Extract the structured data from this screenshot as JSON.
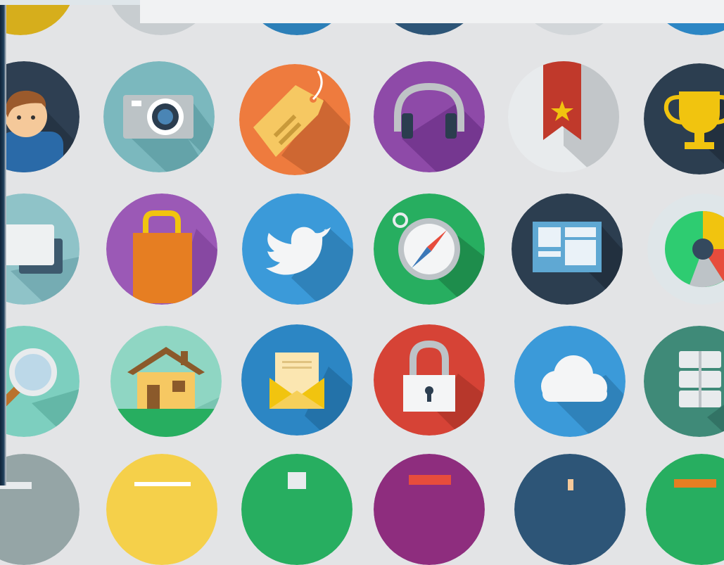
{
  "scene": {
    "description_colors": {
      "background": "#e3e4e6",
      "shadow": "rgba(0,0,0,0.22)"
    }
  },
  "icons": [
    {
      "name": "user-avatar-icon",
      "bg": "#2e3f52"
    },
    {
      "name": "camera-icon",
      "bg": "#7bb8be"
    },
    {
      "name": "price-tag-icon",
      "bg": "#ee7b3e"
    },
    {
      "name": "headphones-icon",
      "bg": "#8e4aa8"
    },
    {
      "name": "bookmark-icon",
      "bg": "#e8ebed"
    },
    {
      "name": "trophy-icon",
      "bg": "#2c3e50"
    },
    {
      "name": "chat-bubble-icon",
      "bg": "#8fc3c8"
    },
    {
      "name": "shopping-bag-icon",
      "bg": "#9b59b6"
    },
    {
      "name": "twitter-bird-icon",
      "bg": "#3b9ad9"
    },
    {
      "name": "compass-icon",
      "bg": "#27ae60"
    },
    {
      "name": "layout-dashboard-icon",
      "bg": "#2c3e50"
    },
    {
      "name": "pie-chart-icon",
      "bg": "#dfe6e9"
    },
    {
      "name": "magnifier-icon",
      "bg": "#7dcfbf"
    },
    {
      "name": "house-icon",
      "bg": "#8fd6c3"
    },
    {
      "name": "mail-envelope-icon",
      "bg": "#2c86c4"
    },
    {
      "name": "padlock-icon",
      "bg": "#d64336"
    },
    {
      "name": "cloud-icon",
      "bg": "#3b9ad9"
    },
    {
      "name": "database-server-icon",
      "bg": "#3f8a78"
    }
  ]
}
